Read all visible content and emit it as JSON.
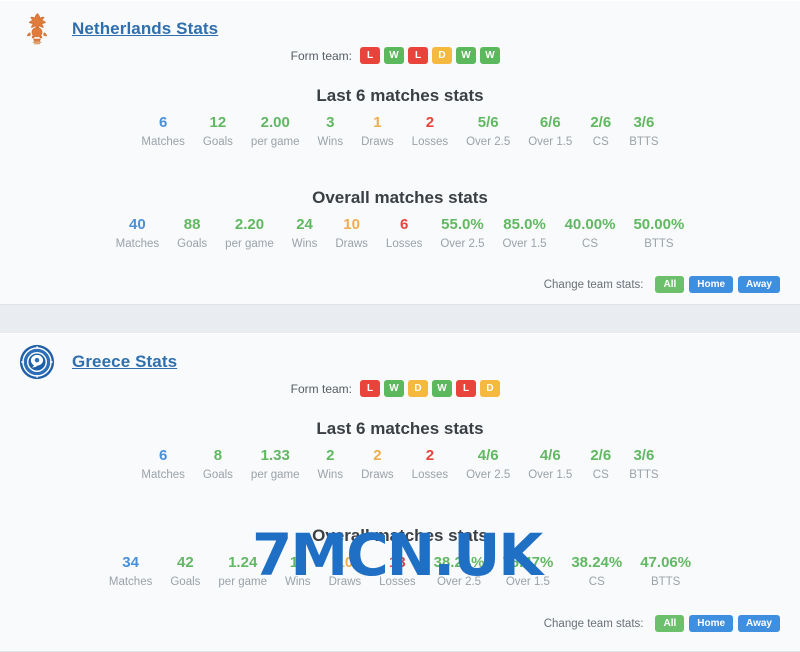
{
  "watermark": {
    "text": "7MCN.UK",
    "color": "#1f6fc4"
  },
  "colors": {
    "accent_link": "#2f6fad",
    "win": "#5cb85c",
    "loss": "#e8443b",
    "draw": "#f5b93f",
    "value_blue": "#4a90d9",
    "value_green": "#62b862",
    "value_orange": "#f0ad4e",
    "value_red": "#e8443b",
    "pill_active": "#6cc06c",
    "pill_inactive": "#3e8fe0",
    "panel_bg": "#f8fafb",
    "page_bg": "#e9edf1"
  },
  "labels": {
    "form_team": "Form team:",
    "last6_title": "Last 6 matches stats",
    "overall_title": "Overall matches stats",
    "change_team_stats": "Change team stats:",
    "pill_all": "All",
    "pill_home": "Home",
    "pill_away": "Away"
  },
  "stat_labels": [
    "Matches",
    "Goals",
    "per game",
    "Wins",
    "Draws",
    "Losses",
    "Over 2.5",
    "Over 1.5",
    "CS",
    "BTTS"
  ],
  "teams": [
    {
      "name": "Netherlands Stats",
      "crest": "netherlands-lion-crest-icon",
      "form": [
        "L",
        "W",
        "L",
        "D",
        "W",
        "W"
      ],
      "last6": {
        "matches": "6",
        "goals": "12",
        "per_game": "2.00",
        "wins": "3",
        "draws": "1",
        "losses": "2",
        "over25": "5/6",
        "over15": "6/6",
        "cs": "2/6",
        "btts": "3/6"
      },
      "overall": {
        "matches": "40",
        "goals": "88",
        "per_game": "2.20",
        "wins": "24",
        "draws": "10",
        "losses": "6",
        "over25": "55.0%",
        "over15": "85.0%",
        "cs": "40.00%",
        "btts": "50.00%"
      },
      "active_filter": "All"
    },
    {
      "name": "Greece Stats",
      "crest": "greece-circular-crest-icon",
      "form": [
        "L",
        "W",
        "D",
        "W",
        "L",
        "D"
      ],
      "last6": {
        "matches": "6",
        "goals": "8",
        "per_game": "1.33",
        "wins": "2",
        "draws": "2",
        "losses": "2",
        "over25": "4/6",
        "over15": "4/6",
        "cs": "2/6",
        "btts": "3/6"
      },
      "overall": {
        "matches": "34",
        "goals": "42",
        "per_game": "1.24",
        "wins": "11",
        "draws": "10",
        "losses": "13",
        "over25": "38.24%",
        "over15": "76.47%",
        "cs": "38.24%",
        "btts": "47.06%"
      },
      "active_filter": "All"
    }
  ]
}
